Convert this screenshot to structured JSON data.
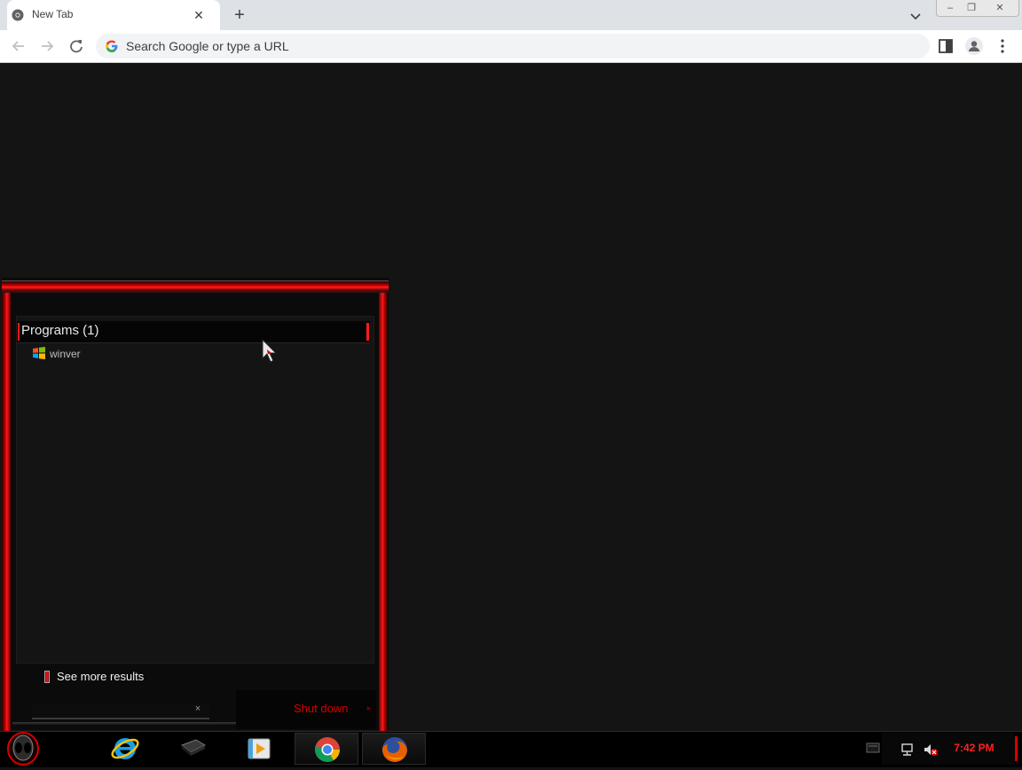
{
  "browser": {
    "tab_title": "New Tab",
    "tab_close": "✕",
    "new_tab": "+",
    "omnibox_placeholder": "Search Google or type a URL",
    "window_controls": {
      "minimize": "–",
      "restore": "❐",
      "close": "✕"
    }
  },
  "start_menu": {
    "programs_header": "Programs (1)",
    "programs": [
      {
        "label": "winver",
        "icon": "windows-logo-icon"
      }
    ],
    "see_more": "See more results",
    "search_clear": "×",
    "shutdown_label": "Shut down",
    "shutdown_arrow": "▸"
  },
  "taskbar": {
    "pinned": [
      {
        "name": "internet-explorer",
        "icon": "internet-explorer-icon"
      },
      {
        "name": "command-line",
        "icon": "terminal-icon"
      },
      {
        "name": "media-player",
        "icon": "media-player-icon"
      },
      {
        "name": "google-chrome",
        "icon": "chrome-icon"
      },
      {
        "name": "firefox",
        "icon": "firefox-icon"
      }
    ],
    "clock": "7:42 PM"
  },
  "colors": {
    "accent_red": "#ff1a1a",
    "shutdown_red": "#d40000",
    "desktop_bg": "#141414"
  }
}
